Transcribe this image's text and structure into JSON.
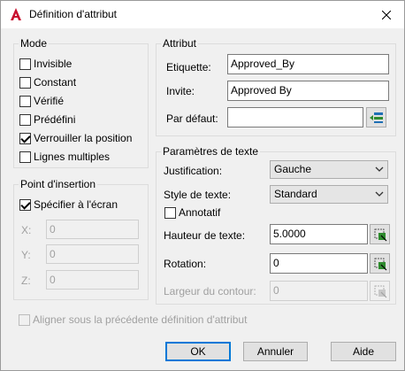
{
  "window": {
    "title": "Définition d'attribut"
  },
  "mode": {
    "title": "Mode",
    "options": [
      {
        "label": "Invisible",
        "checked": false
      },
      {
        "label": "Constant",
        "checked": false
      },
      {
        "label": "Vérifié",
        "checked": false
      },
      {
        "label": "Prédéfini",
        "checked": false
      },
      {
        "label": "Verrouiller la position",
        "checked": true
      },
      {
        "label": "Lignes multiples",
        "checked": false
      }
    ]
  },
  "insertion": {
    "title": "Point d'insertion",
    "specify_label": "Spécifier à l'écran",
    "specify_checked": true,
    "x_label": "X:",
    "x_value": "0",
    "y_label": "Y:",
    "y_value": "0",
    "z_label": "Z:",
    "z_value": "0"
  },
  "attribute": {
    "title": "Attribut",
    "tag_label": "Etiquette:",
    "tag_value": "Approved_By",
    "prompt_label": "Invite:",
    "prompt_value": "Approved By",
    "default_label": "Par défaut:",
    "default_value": ""
  },
  "text_settings": {
    "title": "Paramètres de texte",
    "justification_label": "Justification:",
    "justification_value": "Gauche",
    "style_label": "Style de texte:",
    "style_value": "Standard",
    "annotative_label": "Annotatif",
    "annotative_checked": false,
    "height_label": "Hauteur de texte:",
    "height_value": "5.0000",
    "rotation_label": "Rotation:",
    "rotation_value": "0",
    "boundary_label": "Largeur du contour:",
    "boundary_value": "0"
  },
  "align_label": "Aligner sous la précédente définition d'attribut",
  "buttons": {
    "ok": "OK",
    "cancel": "Annuler",
    "help": "Aide"
  },
  "colors": {
    "accent": "#0078d7",
    "app_icon": "#c8102e",
    "pick_green": "#2e8b2e"
  }
}
